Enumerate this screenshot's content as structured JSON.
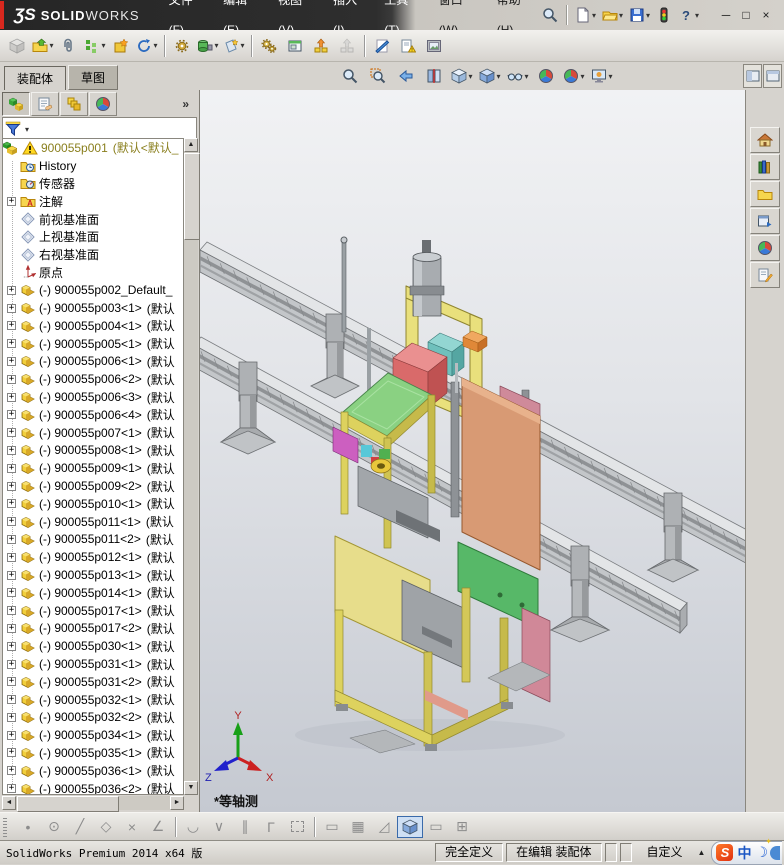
{
  "window": {
    "logo": {
      "mark": "ƷS",
      "solid": "SOLID",
      "works": "WORKS"
    },
    "menus_left": [
      "文件(F)",
      "编辑(E)",
      "视图(V)",
      "插入(I)",
      "工具(T)"
    ],
    "menus_right": [
      "窗口(W)",
      "帮助(H)"
    ],
    "quickbar": [
      {
        "name": "new-document-button",
        "icon": "doc-new",
        "dropdown": true
      },
      {
        "name": "open-button",
        "icon": "folder-open",
        "dropdown": true
      },
      {
        "name": "save-button",
        "icon": "save",
        "dropdown": true
      },
      {
        "name": "options-button",
        "icon": "traffic"
      },
      {
        "name": "help-button",
        "icon": "help",
        "dropdown": true
      }
    ],
    "window_buttons": [
      {
        "name": "minimize-button",
        "glyph": "─"
      },
      {
        "name": "restore-button",
        "glyph": "□"
      },
      {
        "name": "close-button",
        "glyph": "×"
      }
    ]
  },
  "main_toolbar": [
    {
      "name": "edit-component-button",
      "icon": "cube-gray",
      "disabled": true
    },
    {
      "name": "insert-component-button",
      "icon": "folder-part",
      "dropdown": true
    },
    {
      "name": "mate-button",
      "icon": "paperclip"
    },
    {
      "name": "linear-component-pattern-button",
      "icon": "pattern-green",
      "dropdown": true
    },
    {
      "name": "smart-fasteners-button",
      "icon": "box-star"
    },
    {
      "name": "move-component-button",
      "icon": "rotate-arrow",
      "dropdown": true
    },
    {
      "sep": true
    },
    {
      "name": "show-hidden-components-button",
      "icon": "gear-box"
    },
    {
      "name": "assembly-features-button",
      "icon": "drum-tool",
      "dropdown": true
    },
    {
      "name": "reference-geometry-button",
      "icon": "plane-star",
      "dropdown": true
    },
    {
      "sep": true
    },
    {
      "name": "assembly-xpert-button",
      "icon": "gears"
    },
    {
      "name": "preview-window-button",
      "icon": "window-green"
    },
    {
      "name": "exploded-view-button",
      "icon": "explode-orange"
    },
    {
      "name": "explode-line-sketch-button",
      "icon": "explode-gray",
      "disabled": true
    },
    {
      "sep": true
    },
    {
      "name": "section-tool-button",
      "icon": "blue-slash"
    },
    {
      "name": "check-drawing-button",
      "icon": "drawing-alert"
    },
    {
      "name": "capture-image-button",
      "icon": "framed-image"
    }
  ],
  "tabs": [
    {
      "label": "装配体",
      "active": true
    },
    {
      "label": "草图",
      "active": false
    }
  ],
  "hud_toolbar": [
    {
      "name": "zoom-to-fit-button",
      "icon": "magnifier"
    },
    {
      "name": "zoom-to-area-button",
      "icon": "magnifier-area"
    },
    {
      "name": "previous-view-button",
      "icon": "view-back"
    },
    {
      "name": "section-view-button",
      "icon": "section"
    },
    {
      "name": "view-orientation-button",
      "icon": "cube-orient",
      "dropdown": true
    },
    {
      "name": "display-style-button",
      "icon": "cube-shaded",
      "dropdown": true
    },
    {
      "name": "hide-show-items-button",
      "icon": "glasses",
      "dropdown": true
    },
    {
      "name": "edit-appearance-button",
      "icon": "color-ball"
    },
    {
      "name": "apply-scene-button",
      "icon": "color-ball",
      "dropdown": true
    },
    {
      "name": "view-settings-button",
      "icon": "monitor-view",
      "dropdown": true
    }
  ],
  "command_corner": [
    {
      "name": "pin-commandmanager-button",
      "icon": "smallwin1"
    },
    {
      "name": "collapse-commandmanager-button",
      "icon": "smallwin2"
    }
  ],
  "panel": {
    "header_buttons": [
      {
        "name": "featuremanager-tree-tab",
        "icon": "assembly-blocks",
        "active": true
      },
      {
        "name": "propertymanager-tab",
        "icon": "form-hand"
      },
      {
        "name": "configurationmanager-tab",
        "icon": "config-stack"
      },
      {
        "name": "displaymanager-tab",
        "icon": "color-ball"
      }
    ],
    "more_label": "»",
    "filter": {
      "value": "",
      "placeholder": ""
    }
  },
  "tree": {
    "root": {
      "label": "900055p001",
      "suffix": "(默认<默认_"
    },
    "folders": [
      {
        "icon": "history-folder",
        "label": "History"
      },
      {
        "icon": "sensors-folder",
        "label": "传感器"
      },
      {
        "icon": "annotations-folder",
        "label": "注解",
        "expandable": true
      },
      {
        "icon": "plane",
        "label": "前视基准面"
      },
      {
        "icon": "plane",
        "label": "上视基准面"
      },
      {
        "icon": "plane",
        "label": "右视基准面"
      },
      {
        "icon": "origin",
        "label": "原点"
      }
    ],
    "components": [
      {
        "label": "(-) 900055p002_Default_",
        "suffix": ""
      },
      {
        "label": "(-) 900055p003<1>",
        "suffix": "(默认"
      },
      {
        "label": "(-) 900055p004<1>",
        "suffix": "(默认"
      },
      {
        "label": "(-) 900055p005<1>",
        "suffix": "(默认"
      },
      {
        "label": "(-) 900055p006<1>",
        "suffix": "(默认"
      },
      {
        "label": "(-) 900055p006<2>",
        "suffix": "(默认"
      },
      {
        "label": "(-) 900055p006<3>",
        "suffix": "(默认"
      },
      {
        "label": "(-) 900055p006<4>",
        "suffix": "(默认"
      },
      {
        "label": "(-) 900055p007<1>",
        "suffix": "(默认"
      },
      {
        "label": "(-) 900055p008<1>",
        "suffix": "(默认"
      },
      {
        "label": "(-) 900055p009<1>",
        "suffix": "(默认"
      },
      {
        "label": "(-) 900055p009<2>",
        "suffix": "(默认"
      },
      {
        "label": "(-) 900055p010<1>",
        "suffix": "(默认"
      },
      {
        "label": "(-) 900055p011<1>",
        "suffix": "(默认"
      },
      {
        "label": "(-) 900055p011<2>",
        "suffix": "(默认"
      },
      {
        "label": "(-) 900055p012<1>",
        "suffix": "(默认"
      },
      {
        "label": "(-) 900055p013<1>",
        "suffix": "(默认"
      },
      {
        "label": "(-) 900055p014<1>",
        "suffix": "(默认"
      },
      {
        "label": "(-) 900055p017<1>",
        "suffix": "(默认"
      },
      {
        "label": "(-) 900055p017<2>",
        "suffix": "(默认"
      },
      {
        "label": "(-) 900055p030<1>",
        "suffix": "(默认"
      },
      {
        "label": "(-) 900055p031<1>",
        "suffix": "(默认"
      },
      {
        "label": "(-) 900055p031<2>",
        "suffix": "(默认"
      },
      {
        "label": "(-) 900055p032<1>",
        "suffix": "(默认"
      },
      {
        "label": "(-) 900055p032<2>",
        "suffix": "(默认"
      },
      {
        "label": "(-) 900055p034<1>",
        "suffix": "(默认"
      },
      {
        "label": "(-) 900055p035<1>",
        "suffix": "(默认"
      },
      {
        "label": "(-) 900055p036<1>",
        "suffix": "(默认"
      },
      {
        "label": "(-) 900055p036<2>",
        "suffix": "(默认"
      }
    ]
  },
  "viewport": {
    "view_label": "*等轴测",
    "triad": {
      "x": "X",
      "y": "Y",
      "z": "Z"
    }
  },
  "task_pane": [
    {
      "name": "solidworks-resources-tab",
      "icon": "home"
    },
    {
      "name": "design-library-tab",
      "icon": "books"
    },
    {
      "name": "file-explorer-tab",
      "icon": "folder-plain"
    },
    {
      "name": "view-palette-tab",
      "icon": "palette-window"
    },
    {
      "name": "appearances-scenes-tab",
      "icon": "color-ball"
    },
    {
      "name": "custom-properties-tab",
      "icon": "form-pencil"
    }
  ],
  "bottom_toolbar": [
    {
      "name": "sketch-point-button",
      "glyph": "•"
    },
    {
      "name": "sketch-circle-button",
      "glyph": "⊙"
    },
    {
      "name": "sketch-line-button",
      "glyph": "╱"
    },
    {
      "name": "sketch-polygon-button",
      "glyph": "◇"
    },
    {
      "name": "trim-entities-button",
      "glyph": "×"
    },
    {
      "name": "sketch-angle-button",
      "glyph": "∠"
    },
    {
      "sep": true
    },
    {
      "name": "tangent-arc-button",
      "glyph": "◡"
    },
    {
      "name": "snap-button",
      "glyph": "∨"
    },
    {
      "name": "parallel-relation-button",
      "glyph": "∥"
    },
    {
      "name": "corner-rectangle-button",
      "glyph": "Γ"
    },
    {
      "name": "construction-point-button",
      "glyph": "",
      "box": true
    },
    {
      "sep": true
    },
    {
      "name": "fit-rectangle-button",
      "glyph": "▭"
    },
    {
      "name": "grid-button",
      "glyph": "▦"
    },
    {
      "name": "triangle-button",
      "glyph": "◿"
    },
    {
      "name": "shaded-with-edges-button",
      "icon": "cube-shaded",
      "active": true
    },
    {
      "name": "single-viewport-button",
      "glyph": "▭"
    },
    {
      "name": "four-viewport-button",
      "glyph": "⊞"
    }
  ],
  "status_bar": {
    "app": "SolidWorks Premium 2014 x64 版",
    "define_state": "完全定义",
    "edit_state": "在编辑 装配体",
    "custom": "自定义",
    "custom_arrow": "▲",
    "ime": {
      "s": "S",
      "zh": "中",
      "moon": "☽"
    }
  },
  "colors": {
    "brand_red": "#d8281e",
    "titlebar_dark": "#2e2e2e",
    "panel_gray": "#d6d3ce",
    "viewport_top": "#f1f2f4",
    "viewport_bottom": "#c5c9d1",
    "machine_yellow": "#e9e07c",
    "table_green": "#8ad182",
    "panel_salmon": "#d89a74",
    "panel_green": "#57b868",
    "rail_gray": "#c3c6c9",
    "tree_root_text": "#8a7f1e"
  }
}
